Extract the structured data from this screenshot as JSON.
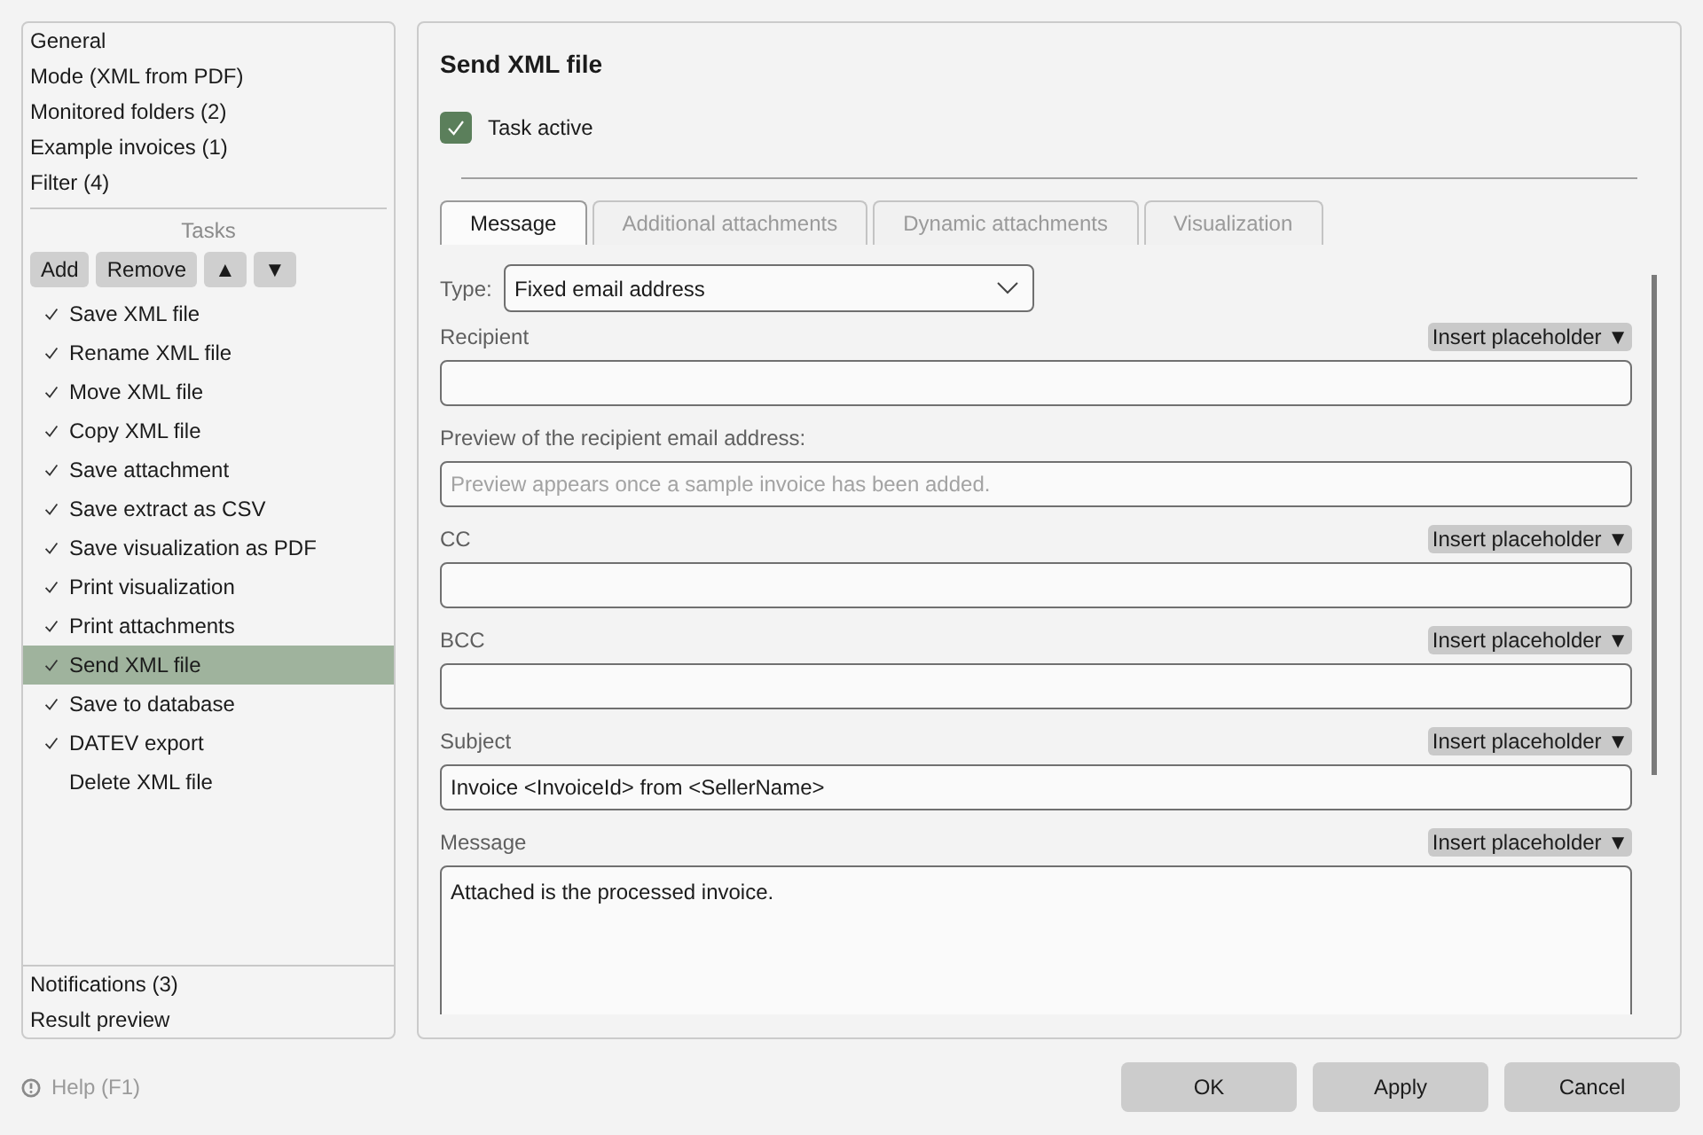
{
  "sidebar": {
    "items": [
      {
        "label": "General",
        "selected": false
      },
      {
        "label": "Mode (XML from PDF)",
        "selected": false
      },
      {
        "label": "Monitored folders (2)",
        "selected": false
      },
      {
        "label": "Example invoices (1)",
        "selected": false
      },
      {
        "label": "Filter (4)",
        "selected": false
      }
    ],
    "tasks_heading": "Tasks",
    "task_buttons": [
      "Add",
      "Remove",
      "▲",
      "▼"
    ],
    "tasks": [
      {
        "label": "Save XML file",
        "checked": true,
        "selected": false
      },
      {
        "label": "Rename XML file",
        "checked": true,
        "selected": false
      },
      {
        "label": "Move XML file",
        "checked": true,
        "selected": false
      },
      {
        "label": "Copy XML file",
        "checked": true,
        "selected": false
      },
      {
        "label": "Save attachment",
        "checked": true,
        "selected": false
      },
      {
        "label": "Save extract as CSV",
        "checked": true,
        "selected": false
      },
      {
        "label": "Save visualization as PDF",
        "checked": true,
        "selected": false
      },
      {
        "label": "Print visualization",
        "checked": true,
        "selected": false
      },
      {
        "label": "Print attachments",
        "checked": true,
        "selected": false
      },
      {
        "label": "Send XML file",
        "checked": true,
        "selected": true
      },
      {
        "label": "Save to database",
        "checked": true,
        "selected": false
      },
      {
        "label": "DATEV export",
        "checked": true,
        "selected": false
      },
      {
        "label": "Delete XML file",
        "checked": false,
        "selected": false
      }
    ],
    "bottom_items": [
      {
        "label": "Notifications (3)",
        "selected": false
      },
      {
        "label": "Result preview",
        "selected": false
      }
    ]
  },
  "panel": {
    "title": "Send XML file",
    "task_active": {
      "label": "Task active",
      "checked": true
    },
    "tabs": [
      {
        "label": "Message",
        "selected": true
      },
      {
        "label": "Additional attachments",
        "selected": false
      },
      {
        "label": "Dynamic attachments",
        "selected": false
      },
      {
        "label": "Visualization",
        "selected": false
      }
    ],
    "type_field": {
      "label": "Type:",
      "value": "Fixed email address"
    },
    "fields": [
      {
        "kind": "input",
        "label": "Recipient",
        "insert_button": "Insert placeholder ▼"
      },
      {
        "kind": "input",
        "label": "Preview of the recipient email address:",
        "placeholder": "Preview appears once a sample invoice has been added."
      },
      {
        "kind": "input",
        "label": "CC",
        "insert_button": "Insert placeholder ▼"
      },
      {
        "kind": "input",
        "label": "BCC",
        "insert_button": "Insert placeholder ▼"
      },
      {
        "kind": "input",
        "label": "Subject",
        "insert_button": "Insert placeholder ▼",
        "value": "Invoice <InvoiceId> from <SellerName>"
      },
      {
        "kind": "textarea",
        "label": "Message",
        "insert_button": "Insert placeholder ▼",
        "value": "Attached is the processed invoice."
      }
    ]
  },
  "help": "Help (F1)",
  "buttons": [
    "OK",
    "Apply",
    "Cancel"
  ]
}
